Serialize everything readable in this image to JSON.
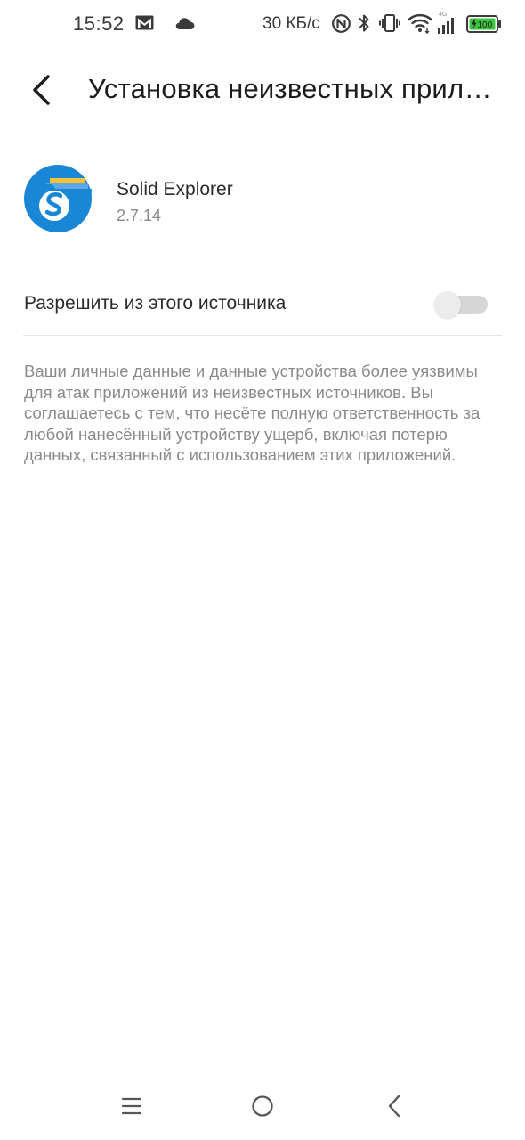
{
  "status_bar": {
    "time": "15:52",
    "net_speed": "30 КБ/с",
    "battery_level": "100",
    "network_type": "4G",
    "icons": [
      "gmail-icon",
      "cloud-icon",
      "nfc-icon",
      "bluetooth-icon",
      "vibrate-icon",
      "wifi-icon",
      "signal-icon",
      "battery-icon"
    ],
    "battery_color": "#3ec43e"
  },
  "header": {
    "title": "Установка неизвестных приложений"
  },
  "app": {
    "name": "Solid Explorer",
    "version": "2.7.14",
    "icon_colors": {
      "background": "#1a86d6",
      "folder_top": "#f2c23b",
      "folder_back": "#5fa8e8"
    }
  },
  "settings": {
    "allow_label": "Разрешить из этого источника",
    "allow_enabled": false
  },
  "warning": "Ваши личные данные и данные устройства более уязвимы для атак приложений из неизвестных источников. Вы соглашаетесь с тем, что несёте полную ответственность за любой нанесённый устройству ущерб, включая потерю данных, связанный с использованием этих приложений.",
  "nav_bar": {
    "buttons": [
      "menu-icon",
      "home-icon",
      "back-icon"
    ]
  }
}
